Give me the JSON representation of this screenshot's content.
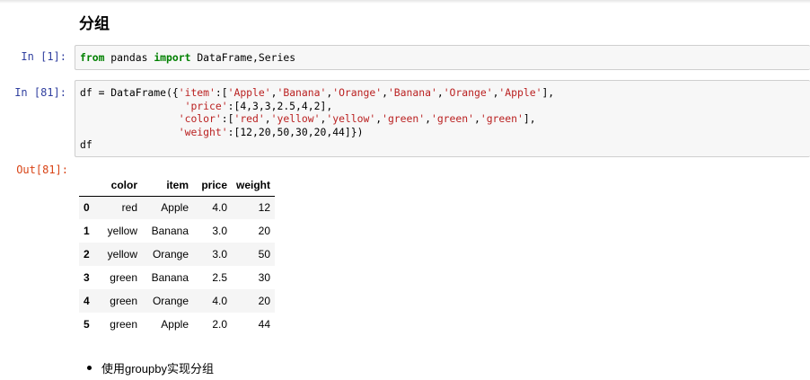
{
  "markdown": {
    "heading": "分组",
    "bullet": "使用groupby实现分组"
  },
  "cells": [
    {
      "prompt": "In  [1]:",
      "code_lines": [
        [
          {
            "t": "kw",
            "v": "from"
          },
          {
            "t": "n",
            "v": " pandas "
          },
          {
            "t": "kw",
            "v": "import"
          },
          {
            "t": "n",
            "v": " DataFrame,Series"
          }
        ]
      ]
    },
    {
      "prompt": "In  [81]:",
      "code_lines": [
        [
          {
            "t": "n",
            "v": "df = DataFrame({"
          },
          {
            "t": "s",
            "v": "'item'"
          },
          {
            "t": "n",
            "v": ":["
          },
          {
            "t": "s",
            "v": "'Apple'"
          },
          {
            "t": "n",
            "v": ","
          },
          {
            "t": "s",
            "v": "'Banana'"
          },
          {
            "t": "n",
            "v": ","
          },
          {
            "t": "s",
            "v": "'Orange'"
          },
          {
            "t": "n",
            "v": ","
          },
          {
            "t": "s",
            "v": "'Banana'"
          },
          {
            "t": "n",
            "v": ","
          },
          {
            "t": "s",
            "v": "'Orange'"
          },
          {
            "t": "n",
            "v": ","
          },
          {
            "t": "s",
            "v": "'Apple'"
          },
          {
            "t": "n",
            "v": "],"
          }
        ],
        [
          {
            "t": "n",
            "v": "                 "
          },
          {
            "t": "s",
            "v": "'price'"
          },
          {
            "t": "n",
            "v": ":[4,3,3,2.5,4,2],"
          }
        ],
        [
          {
            "t": "n",
            "v": "                "
          },
          {
            "t": "s",
            "v": "'color'"
          },
          {
            "t": "n",
            "v": ":["
          },
          {
            "t": "s",
            "v": "'red'"
          },
          {
            "t": "n",
            "v": ","
          },
          {
            "t": "s",
            "v": "'yellow'"
          },
          {
            "t": "n",
            "v": ","
          },
          {
            "t": "s",
            "v": "'yellow'"
          },
          {
            "t": "n",
            "v": ","
          },
          {
            "t": "s",
            "v": "'green'"
          },
          {
            "t": "n",
            "v": ","
          },
          {
            "t": "s",
            "v": "'green'"
          },
          {
            "t": "n",
            "v": ","
          },
          {
            "t": "s",
            "v": "'green'"
          },
          {
            "t": "n",
            "v": "],"
          }
        ],
        [
          {
            "t": "n",
            "v": "                "
          },
          {
            "t": "s",
            "v": "'weight'"
          },
          {
            "t": "n",
            "v": ":[12,20,50,30,20,44]})"
          }
        ],
        [
          {
            "t": "n",
            "v": "df"
          }
        ]
      ],
      "output_prompt": "Out[81]:"
    }
  ],
  "dataframe": {
    "columns": [
      "",
      "color",
      "item",
      "price",
      "weight"
    ],
    "rows": [
      [
        "0",
        "red",
        "Apple",
        "4.0",
        "12"
      ],
      [
        "1",
        "yellow",
        "Banana",
        "3.0",
        "20"
      ],
      [
        "2",
        "yellow",
        "Orange",
        "3.0",
        "50"
      ],
      [
        "3",
        "green",
        "Banana",
        "2.5",
        "30"
      ],
      [
        "4",
        "green",
        "Orange",
        "4.0",
        "20"
      ],
      [
        "5",
        "green",
        "Apple",
        "2.0",
        "44"
      ]
    ]
  },
  "colors": {
    "in_prompt": "#303f9f",
    "out_prompt": "#d84315",
    "keyword": "#008000",
    "string": "#ba2121",
    "cell_bg": "#f7f7f7"
  }
}
